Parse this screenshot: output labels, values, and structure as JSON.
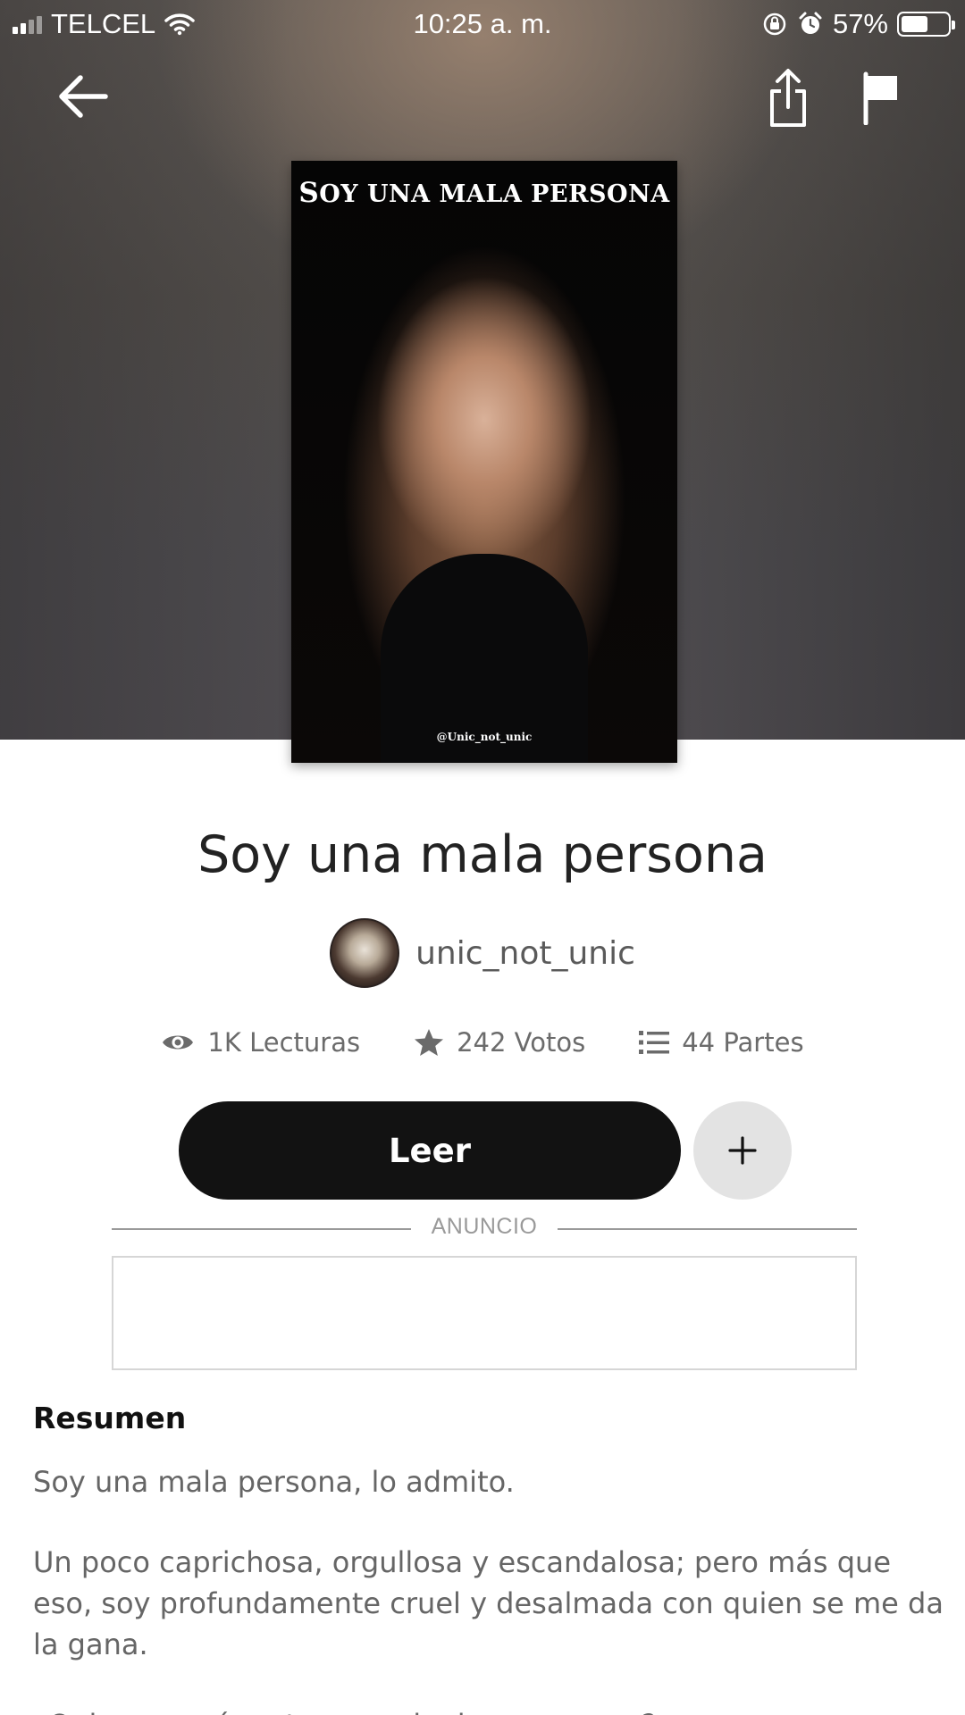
{
  "status_bar": {
    "carrier": "TELCEL",
    "time": "10:25 a. m.",
    "battery_percent": "57%",
    "battery_level": 0.57
  },
  "top_bar": {
    "icons": [
      "back-arrow-icon",
      "share-icon",
      "flag-icon"
    ]
  },
  "cover": {
    "title_first": "S",
    "title_small1": "OY ",
    "title_rest": "UNA MALA PERSONA",
    "handle": "@Unic_not_unic"
  },
  "story": {
    "title": "Soy una mala persona",
    "author": "unic_not_unic",
    "stats": {
      "reads": "1K Lecturas",
      "votes": "242 Votos",
      "parts": "44 Partes"
    },
    "read_button": "Leer",
    "add_icon": "plus-icon"
  },
  "ad": {
    "label": "ANUNCIO"
  },
  "summary": {
    "heading": "Resumen",
    "paragraphs": [
      "Soy una mala persona, lo admito.",
      "Un poco caprichosa, orgullosa y escandalosa; pero más que eso, soy profundamente cruel y desalmada con quien se me da la gana.",
      "¿Quien querría estar con alguien como yo ?"
    ]
  },
  "colors": {
    "button_dark": "#121212",
    "add_button_bg": "#e3e3e3",
    "muted_text": "#6b6b6b"
  }
}
